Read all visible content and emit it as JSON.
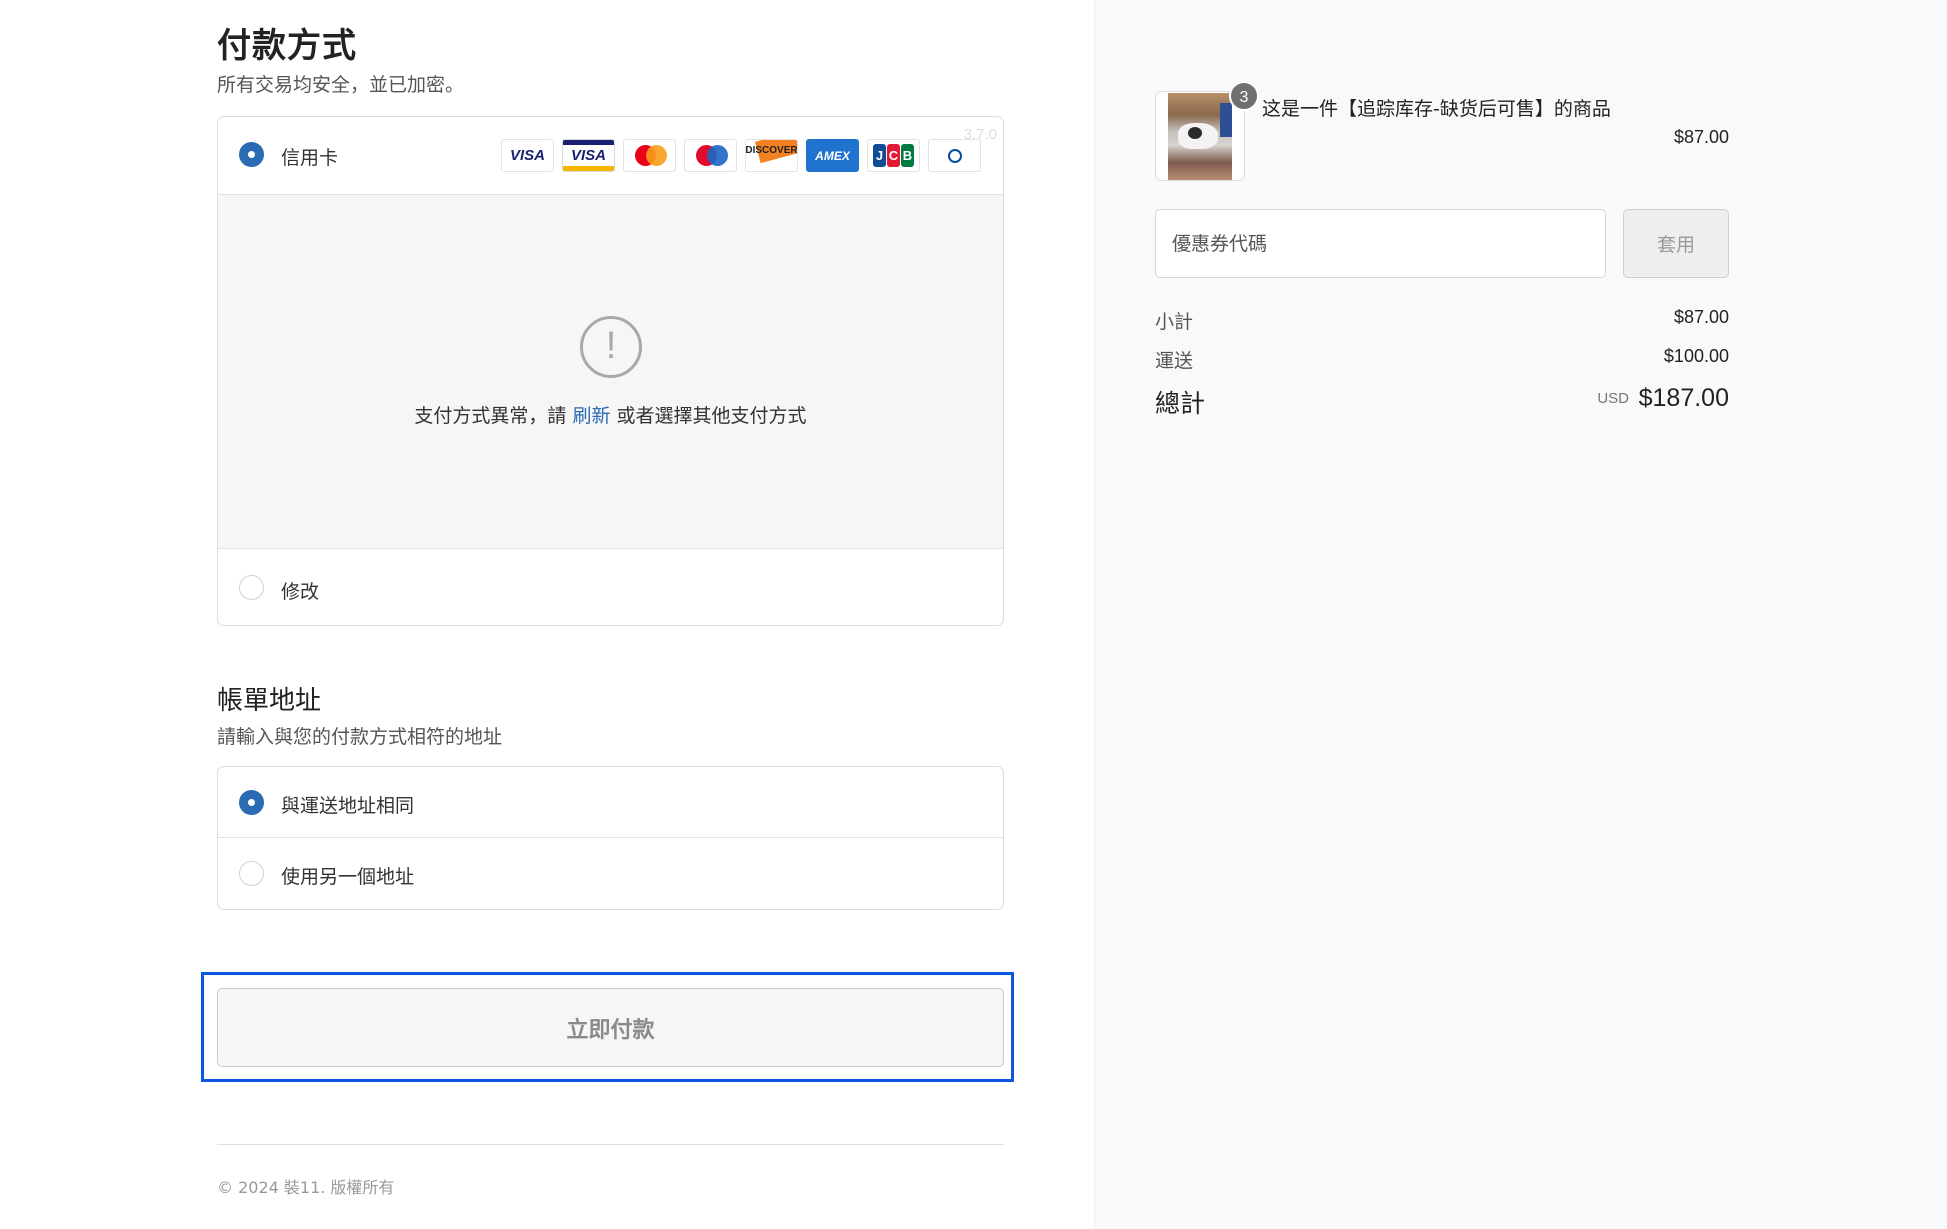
{
  "payment": {
    "title": "付款方式",
    "subtitle": "所有交易均安全，並已加密。",
    "version": "3.7.0",
    "credit_card_label": "信用卡",
    "card_brands": [
      "VISA",
      "VISA Electron",
      "Mastercard",
      "Maestro",
      "DISCOVER",
      "AMEX",
      "JCB",
      "Diners Club"
    ],
    "error_prefix": "支付方式異常，請",
    "error_link": "刷新",
    "error_suffix": "或者選擇其他支付方式",
    "error_icon": "!",
    "alt_option_label": "修改"
  },
  "billing": {
    "title": "帳單地址",
    "subtitle": "請輸入與您的付款方式相符的地址",
    "same_label": "與運送地址相同",
    "different_label": "使用另一個地址"
  },
  "pay_button_label": "立即付款",
  "footer_text": "© 2024 裝11. 版權所有",
  "order": {
    "product_name": "这是一件【追踪库存-缺货后可售】的商品",
    "product_price": "$87.00",
    "quantity": "3",
    "coupon_placeholder": "優惠券代碼",
    "apply_label": "套用",
    "subtotal_label": "小計",
    "subtotal_value": "$87.00",
    "shipping_label": "運送",
    "shipping_value": "$100.00",
    "total_label": "總計",
    "currency": "USD",
    "total_value": "$187.00"
  },
  "colors": {
    "accent": "#2a6bb3",
    "focus_outline": "#0a57e0",
    "sidebar_bg": "#f8f9fb"
  }
}
